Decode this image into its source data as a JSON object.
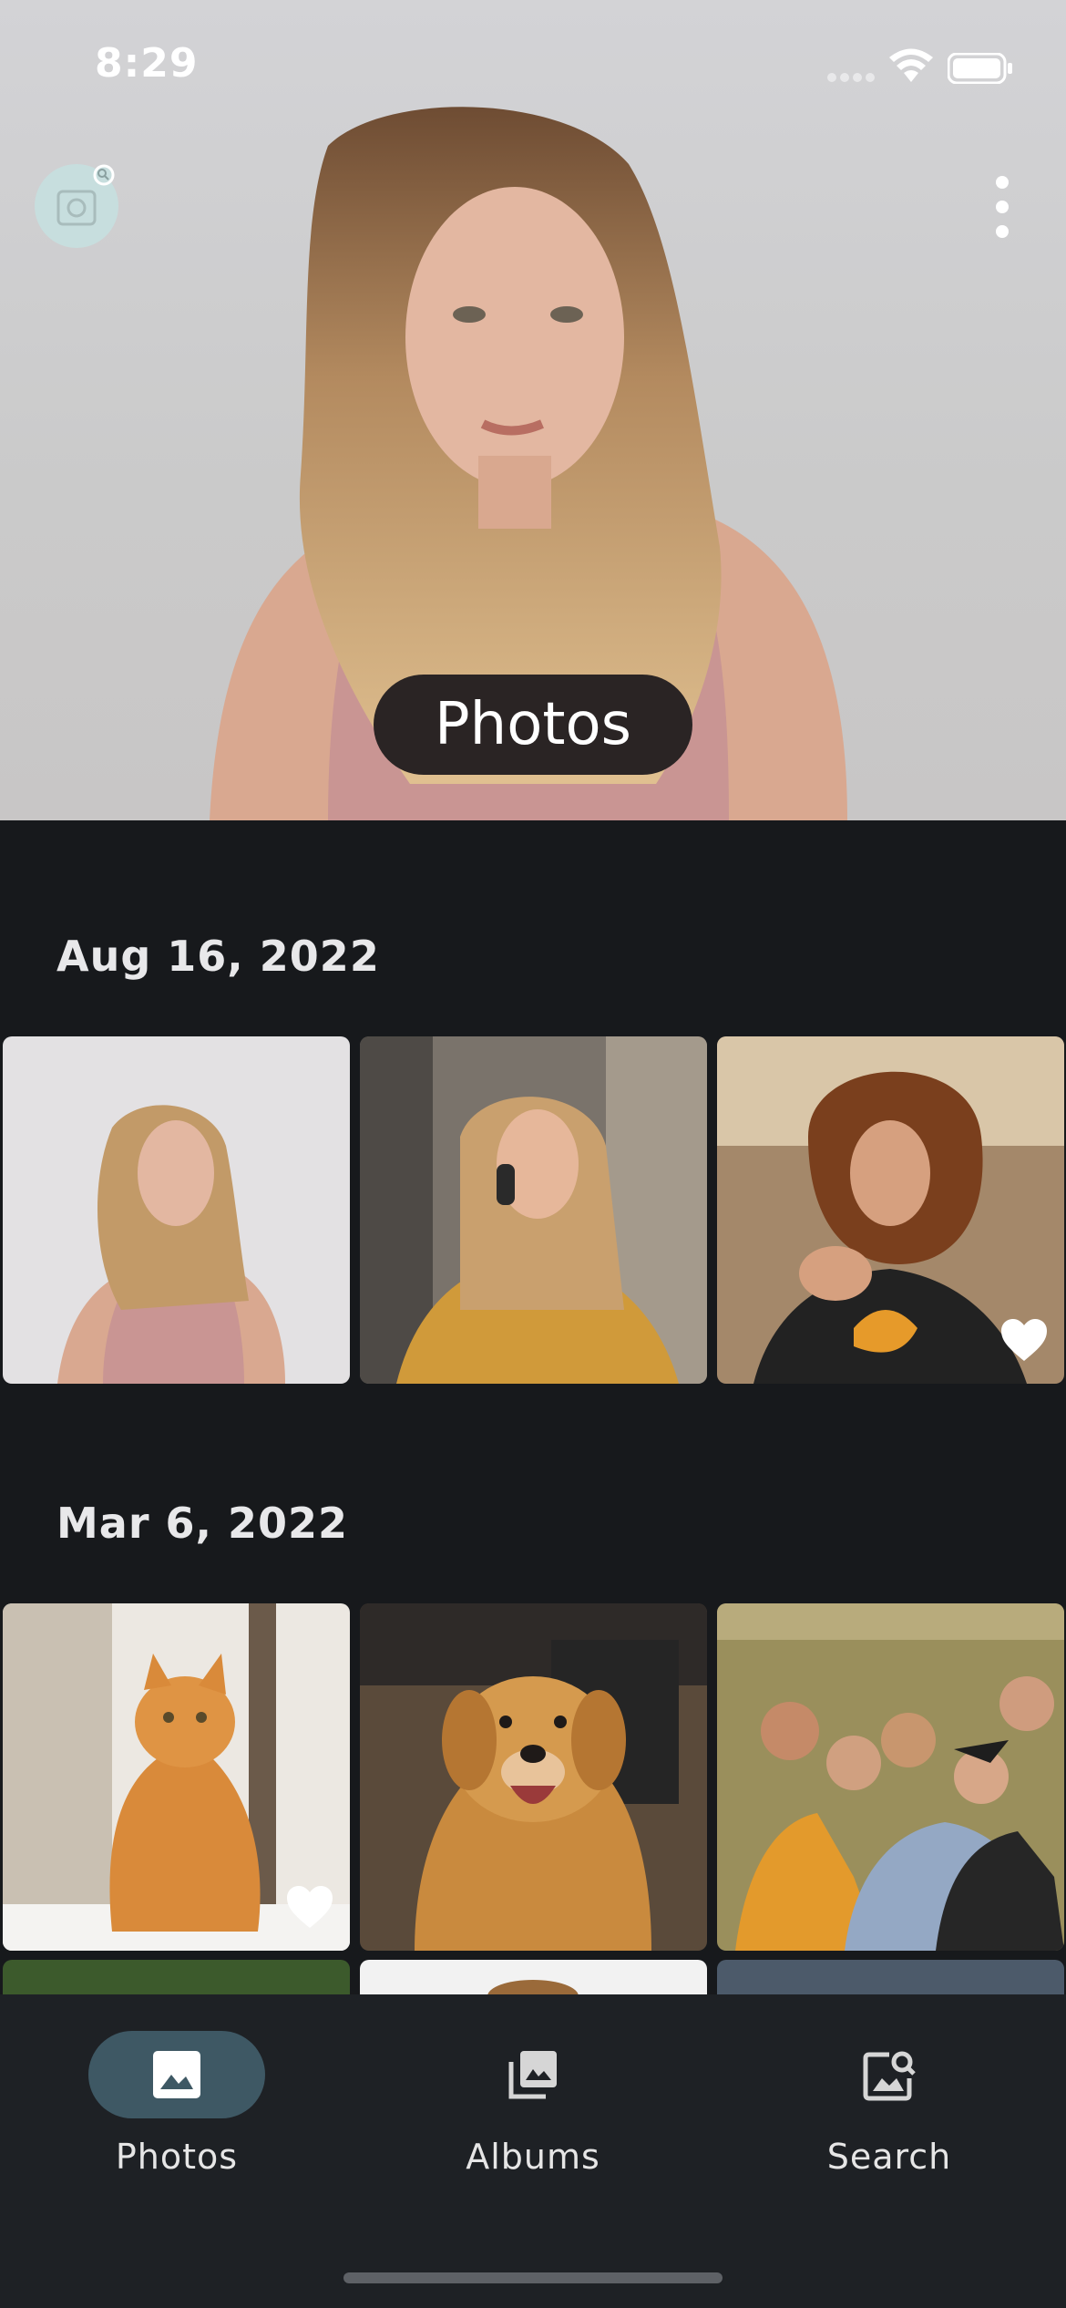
{
  "status_bar": {
    "time": "8:29"
  },
  "hero": {
    "title": "Photos"
  },
  "sections": [
    {
      "date": "Aug 16, 2022",
      "photos": [
        {
          "subject": "woman-pink-top",
          "favorite": false
        },
        {
          "subject": "woman-on-phone",
          "favorite": false
        },
        {
          "subject": "woman-curly-hair",
          "favorite": true
        }
      ]
    },
    {
      "date": "Mar 6, 2022",
      "photos": [
        {
          "subject": "orange-cat",
          "favorite": true
        },
        {
          "subject": "golden-retriever",
          "favorite": false
        },
        {
          "subject": "group-of-friends",
          "favorite": false
        }
      ]
    }
  ],
  "nav": {
    "items": [
      {
        "label": "Photos",
        "icon": "photo-icon",
        "active": true
      },
      {
        "label": "Albums",
        "icon": "albums-icon",
        "active": false
      },
      {
        "label": "Search",
        "icon": "image-search-icon",
        "active": false
      }
    ]
  },
  "colors": {
    "background": "#17191c",
    "nav_active": "#3e5864",
    "pill": "#2a2424"
  }
}
